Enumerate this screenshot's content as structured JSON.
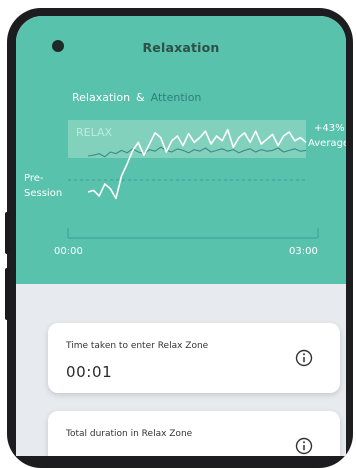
{
  "header": {
    "title": "Relaxation"
  },
  "legend": {
    "relaxation": "Relaxation",
    "separator": "&",
    "attention": "Attention"
  },
  "chart": {
    "zone_label": "RELAX",
    "pre_session_label": "Pre-\nSession",
    "change_value": "+43%",
    "change_label": "Average",
    "x_start": "00:00",
    "x_end": "03:00"
  },
  "chart_data": {
    "type": "line",
    "series": [
      {
        "name": "Relaxation",
        "color": "#ffffff",
        "values": [
          0.1,
          0.12,
          0.05,
          0.2,
          0.14,
          0.02,
          0.3,
          0.45,
          0.62,
          0.72,
          0.56,
          0.7,
          0.84,
          0.78,
          0.6,
          0.74,
          0.8,
          0.68,
          0.83,
          0.72,
          0.78,
          0.86,
          0.7,
          0.8,
          0.74,
          0.88,
          0.66,
          0.78,
          0.84,
          0.72,
          0.86,
          0.7,
          0.76,
          0.82,
          0.68,
          0.8,
          0.85,
          0.74,
          0.78,
          0.72
        ]
      },
      {
        "name": "Attention",
        "color": "#2d7f7b",
        "values": [
          0.55,
          0.56,
          0.58,
          0.54,
          0.6,
          0.58,
          0.62,
          0.59,
          0.64,
          0.6,
          0.58,
          0.63,
          0.61,
          0.66,
          0.62,
          0.6,
          0.64,
          0.62,
          0.59,
          0.63,
          0.61,
          0.65,
          0.6,
          0.62,
          0.64,
          0.61,
          0.63,
          0.59,
          0.62,
          0.64,
          0.6,
          0.63,
          0.61,
          0.62,
          0.65,
          0.6,
          0.62,
          0.64,
          0.61,
          0.62
        ]
      }
    ],
    "colors": {
      "zone": "#8fd5c1",
      "baseline": "#3f9e8e"
    }
  },
  "cards": [
    {
      "label": "Time taken to enter Relax Zone",
      "value": "00:01"
    },
    {
      "label": "Total duration in Relax Zone",
      "value": ""
    }
  ],
  "icons": {
    "back": "camera-dot-icon",
    "info": "info-icon"
  }
}
